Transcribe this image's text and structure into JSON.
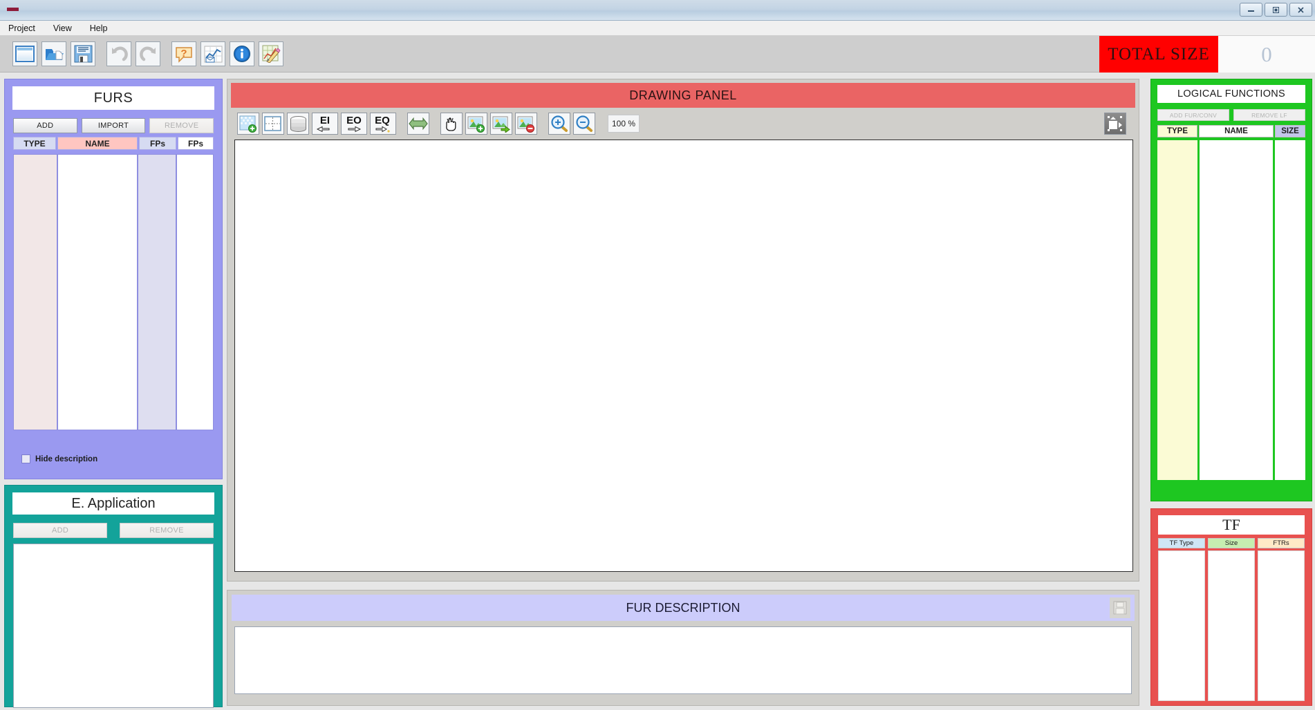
{
  "window": {
    "controls": [
      {
        "name": "minimize",
        "glyph": "–"
      },
      {
        "name": "maximize",
        "glyph": "□"
      },
      {
        "name": "close",
        "glyph": "✖"
      }
    ]
  },
  "menubar": {
    "items": [
      {
        "label": "Project"
      },
      {
        "label": "View"
      },
      {
        "label": "Help"
      }
    ]
  },
  "toolbar": {
    "buttons": [
      {
        "name": "new-project-icon",
        "title": "New"
      },
      {
        "name": "open-folder-icon",
        "title": "Open"
      },
      {
        "name": "save-floppy-icon",
        "title": "Save"
      },
      {
        "name": "undo-arrow-icon",
        "title": "Undo"
      },
      {
        "name": "redo-arrow-icon",
        "title": "Redo"
      },
      {
        "name": "help-question-icon",
        "title": "Help"
      },
      {
        "name": "chart-report-icon",
        "title": "Report"
      },
      {
        "name": "info-icon",
        "title": "Info"
      },
      {
        "name": "edit-pencil-icon",
        "title": "Edit"
      }
    ],
    "total_size_label": "TOTAL SIZE",
    "total_size_value": "0"
  },
  "furs": {
    "title": "FURS",
    "buttons": [
      {
        "label": "ADD",
        "disabled": false
      },
      {
        "label": "IMPORT",
        "disabled": false
      },
      {
        "label": "REMOVE",
        "disabled": true
      }
    ],
    "columns": [
      "TYPE",
      "NAME",
      "FPs",
      "FPs"
    ],
    "rows": [],
    "hide_description_label": "Hide description",
    "hide_description_checked": false
  },
  "eapplication": {
    "title": "E. Application",
    "buttons": [
      {
        "label": "ADD",
        "disabled": true
      },
      {
        "label": "REMOVE",
        "disabled": true
      }
    ],
    "items": []
  },
  "drawing": {
    "title": "DRAWING PANEL",
    "tools": [
      {
        "name": "add-area-icon"
      },
      {
        "name": "grid-area-icon"
      },
      {
        "name": "database-icon"
      },
      {
        "name": "ei-input-icon",
        "text": "EI"
      },
      {
        "name": "eo-output-icon",
        "text": "EO"
      },
      {
        "name": "eq-query-icon",
        "text": "EQ"
      },
      {
        "name": "link-arrow-icon"
      },
      {
        "name": "hand-pan-icon"
      },
      {
        "name": "image-add-icon"
      },
      {
        "name": "image-move-icon"
      },
      {
        "name": "image-remove-icon"
      },
      {
        "name": "zoom-in-icon"
      },
      {
        "name": "zoom-out-icon"
      }
    ],
    "zoom_level": "100 %",
    "export_button": "export-icon"
  },
  "fur_description": {
    "title": "FUR DESCRIPTION",
    "save_icon": "save-floppy-icon",
    "text": ""
  },
  "logical_functions": {
    "title": "LOGICAL FUNCTIONS",
    "buttons": [
      {
        "label": "ADD FUR/CONV",
        "disabled": true
      },
      {
        "label": "REMOVE LF",
        "disabled": true
      }
    ],
    "columns": [
      "TYPE",
      "NAME",
      "SIZE"
    ],
    "rows": []
  },
  "tf": {
    "title": "TF",
    "columns": [
      "TF Type",
      "Size",
      "FTRs"
    ],
    "rows": []
  },
  "colors": {
    "furs_panel": "#9a99f0",
    "eapp_panel": "#13a39a",
    "drawing_header": "#ea6464",
    "lf_panel": "#1ec721",
    "tf_panel": "#e8514f",
    "total_size_bg": "#ff0000",
    "description_header": "#ccccfb"
  }
}
